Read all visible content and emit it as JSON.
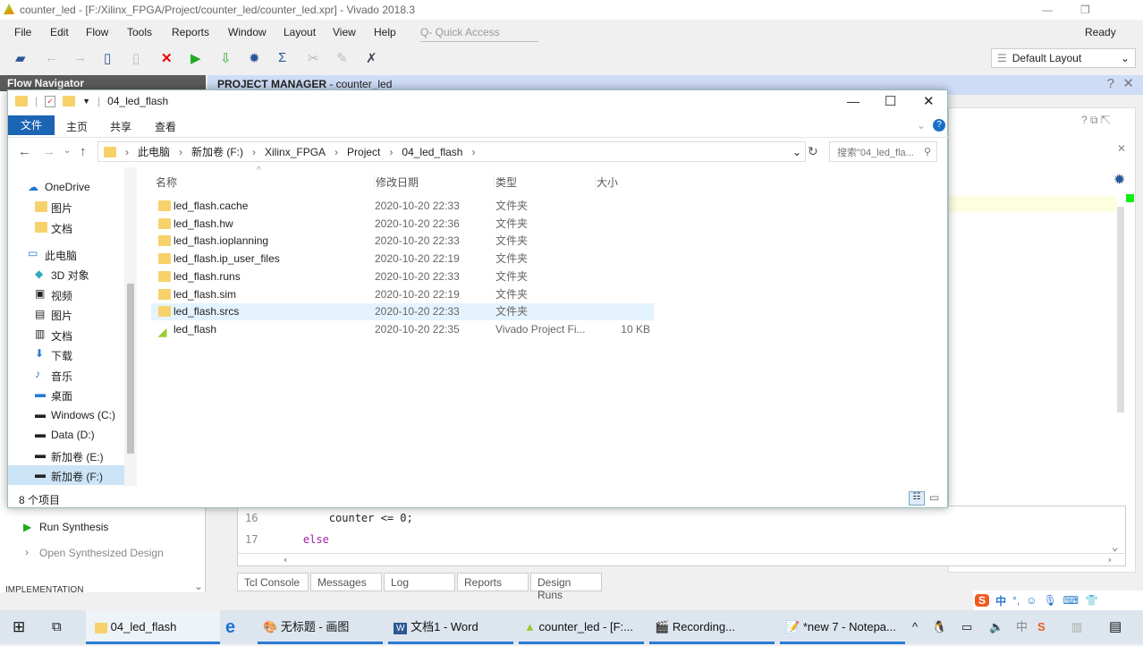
{
  "vivado": {
    "title": "counter_led - [F:/Xilinx_FPGA/Project/counter_led/counter_led.xpr] - Vivado 2018.3",
    "status": "Ready",
    "menu": [
      "File",
      "Edit",
      "Flow",
      "Tools",
      "Reports",
      "Window",
      "Layout",
      "View",
      "Help"
    ],
    "quick_access_placeholder": "Q- Quick Access",
    "layout_select": "Default Layout",
    "flow_navigator": "Flow Navigator",
    "project_manager": "PROJECT MANAGER",
    "project_name": " - counter_led",
    "run_synthesis": "Run Synthesis",
    "open_synth": "Open Synthesized Design",
    "implementation": "IMPLEMENTATION",
    "code": [
      {
        "line": "16",
        "text": "        counter <= 0;"
      },
      {
        "line": "17",
        "text": "    else"
      }
    ],
    "bottom_tabs": [
      "Tcl Console",
      "Messages",
      "Log",
      "Reports",
      "Design Runs"
    ]
  },
  "explorer": {
    "title": "04_led_flash",
    "ribbon_tabs": [
      "文件",
      "主页",
      "共享",
      "查看"
    ],
    "breadcrumb": [
      "此电脑",
      "新加卷 (F:)",
      "Xilinx_FPGA",
      "Project",
      "04_led_flash"
    ],
    "search_placeholder": "搜索\"04_led_fla...",
    "nav": [
      "OneDrive",
      "图片",
      "文档",
      "此电脑",
      "3D 对象",
      "视频",
      "图片",
      "文档",
      "下载",
      "音乐",
      "桌面",
      "Windows (C:)",
      "Data (D:)",
      "新加卷 (E:)",
      "新加卷 (F:)"
    ],
    "columns": [
      "名称",
      "修改日期",
      "类型",
      "大小"
    ],
    "files": [
      {
        "name": "led_flash.cache",
        "date": "2020-10-20 22:33",
        "type": "文件夹",
        "size": ""
      },
      {
        "name": "led_flash.hw",
        "date": "2020-10-20 22:36",
        "type": "文件夹",
        "size": ""
      },
      {
        "name": "led_flash.ioplanning",
        "date": "2020-10-20 22:33",
        "type": "文件夹",
        "size": ""
      },
      {
        "name": "led_flash.ip_user_files",
        "date": "2020-10-20 22:19",
        "type": "文件夹",
        "size": ""
      },
      {
        "name": "led_flash.runs",
        "date": "2020-10-20 22:33",
        "type": "文件夹",
        "size": ""
      },
      {
        "name": "led_flash.sim",
        "date": "2020-10-20 22:19",
        "type": "文件夹",
        "size": ""
      },
      {
        "name": "led_flash.srcs",
        "date": "2020-10-20 22:33",
        "type": "文件夹",
        "size": ""
      },
      {
        "name": "led_flash",
        "date": "2020-10-20 22:35",
        "type": "Vivado Project Fi...",
        "size": "10 KB"
      }
    ],
    "status": "8 个项目"
  },
  "taskbar": [
    "04_led_flash",
    "无标题 - 画图",
    "文档1 - Word",
    "counter_led - [F:...",
    "Recording...",
    "*new 7 - Notepa..."
  ],
  "ime": "中"
}
